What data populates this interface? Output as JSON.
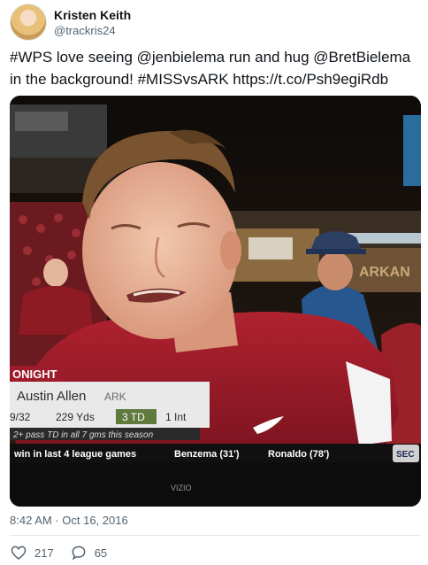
{
  "author": {
    "name": "Kristen Keith",
    "handle": "@trackris24"
  },
  "tweet": {
    "text_lead": "#WPS love seeing @jenbielema run and hug @BretBielema in the background! #MISSvsARK ",
    "link": "https://t.co/Psh9egiRdb"
  },
  "media": {
    "bug_label": "ONIGHT",
    "player_name": "Austin Allen",
    "team": "ARK",
    "stat_comp": "9/32",
    "stat_yds": "229 Yds",
    "stat_td": "3 TD",
    "stat_int": "1 Int",
    "note": "2+ pass TD in all 7 gms this season",
    "ticker_left": "win in last 4 league games",
    "ticker_mid": "Benzema (31')",
    "ticker_right": "Ronaldo (78')",
    "network": "SEC",
    "tv_brand": "VIZIO",
    "stadium_sign": "ARKAN"
  },
  "timestamp": "8:42 AM · Oct 16, 2016",
  "metrics": {
    "likes": "217",
    "replies": "65"
  },
  "colors": {
    "text": "#0f1419",
    "muted": "#536471",
    "razorback_red": "#9d1b2a",
    "td_green": "#5f7a3c"
  }
}
